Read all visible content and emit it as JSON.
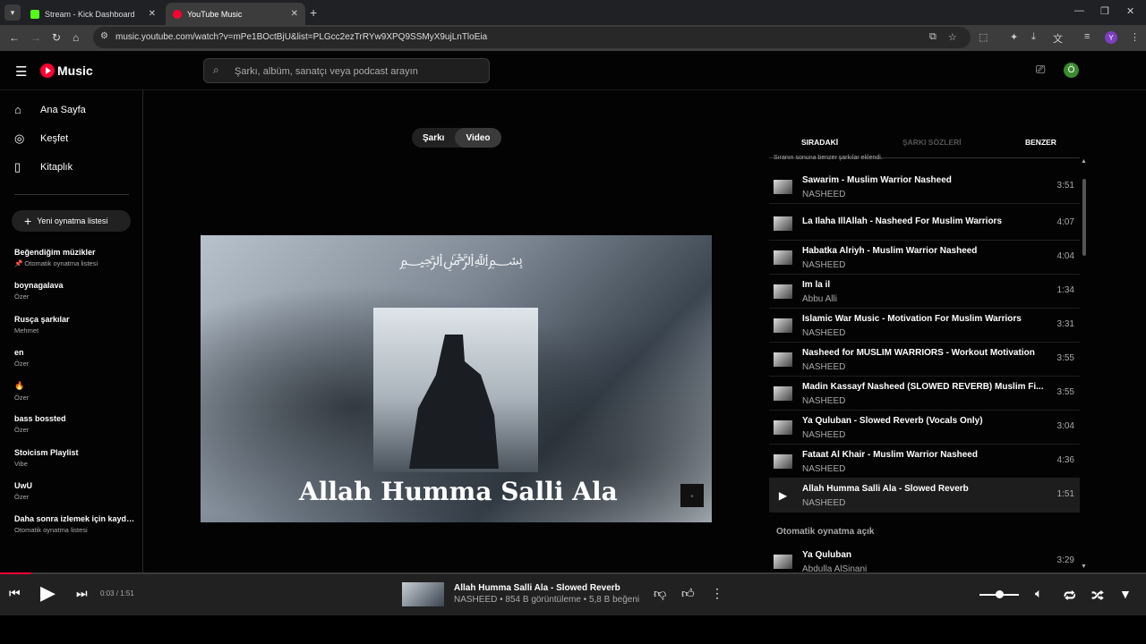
{
  "browser": {
    "tabs": [
      {
        "title": "Stream - Kick Dashboard",
        "favicon_color": "#53fc18"
      },
      {
        "title": "YouTube Music",
        "favicon_color": "#ff0033"
      }
    ],
    "url": "music.youtube.com/watch?v=mPe1BOctBjU&list=PLGcc2ezTrRYw9XPQ9SSMyX9ujLnTloEia",
    "profile_initial": "Y"
  },
  "header": {
    "logo_text": "Music",
    "search_placeholder": "Şarkı, albüm, sanatçı veya podcast arayın",
    "user_initial": "Ö"
  },
  "sidebar": {
    "nav": [
      {
        "label": "Ana Sayfa",
        "icon": "home-icon"
      },
      {
        "label": "Keşfet",
        "icon": "compass-icon"
      },
      {
        "label": "Kitaplık",
        "icon": "library-icon"
      }
    ],
    "new_playlist_label": "Yeni oynatma listesi",
    "playlists": [
      {
        "title": "Beğendiğim müzikler",
        "subtitle": "📌 Otomatik oynatma listesi"
      },
      {
        "title": "boynagalava",
        "subtitle": "Özer"
      },
      {
        "title": "Rusça şarkılar",
        "subtitle": "Mehmet"
      },
      {
        "title": "en",
        "subtitle": "Özer"
      },
      {
        "title": "🔥",
        "subtitle": "Özer"
      },
      {
        "title": "bass bossted",
        "subtitle": "Özer"
      },
      {
        "title": "Stoicism Playlist",
        "subtitle": "Vibe"
      },
      {
        "title": "UwU",
        "subtitle": "Özer"
      },
      {
        "title": "Daha sonra izlemek için kaydedilenler",
        "subtitle": "Otomatik oynatma listesi"
      }
    ]
  },
  "player": {
    "toggle": {
      "song": "Şarkı",
      "video": "Video",
      "selected": "Video"
    },
    "video_caption": "Allah Humma Salli Ala"
  },
  "queue": {
    "tabs": [
      "SIRADAKİ",
      "ŞARKI SÖZLERİ",
      "BENZER"
    ],
    "note": "Sıranın sonuna benzer şarkılar eklendi.",
    "items": [
      {
        "title": "Sawarim - Muslim Warrior Nasheed",
        "artist": "NASHEED",
        "duration": "3:51"
      },
      {
        "title": "La Ilaha IllAllah - Nasheed For Muslim Warriors",
        "artist": "",
        "duration": "4:07"
      },
      {
        "title": "Habatka Alriyh - Muslim Warrior Nasheed",
        "artist": "NASHEED",
        "duration": "4:04"
      },
      {
        "title": "Im la il",
        "artist": "Abbu Alli",
        "duration": "1:34"
      },
      {
        "title": "Islamic War Music - Motivation For Muslim Warriors",
        "artist": "NASHEED",
        "duration": "3:31"
      },
      {
        "title": "Nasheed for MUSLIM WARRIORS - Workout Motivation",
        "artist": "NASHEED",
        "duration": "3:55"
      },
      {
        "title": "Madin Kassayf Nasheed (SLOWED REVERB) Muslim Fi...",
        "artist": "NASHEED",
        "duration": "3:55"
      },
      {
        "title": "Ya Quluban - Slowed Reverb (Vocals Only)",
        "artist": "NASHEED",
        "duration": "3:04"
      },
      {
        "title": "Fataat Al Khair - Muslim Warrior Nasheed",
        "artist": "NASHEED",
        "duration": "4:36"
      },
      {
        "title": "Allah Humma Salli Ala - Slowed Reverb",
        "artist": "NASHEED",
        "duration": "1:51",
        "active": true
      }
    ],
    "autoplay_label": "Otomatik oynatma açık",
    "autoplay_items": [
      {
        "title": "Ya Quluban",
        "artist": "Abdulla AlSinani",
        "duration": "3:29"
      }
    ]
  },
  "now_playing": {
    "time": "0:03 / 1:51",
    "progress": 0.027,
    "title": "Allah Humma Salli Ala - Slowed Reverb",
    "subtitle": "NASHEED • 854 B görüntüleme • 5,8 B beğeni",
    "volume": 0.5
  }
}
